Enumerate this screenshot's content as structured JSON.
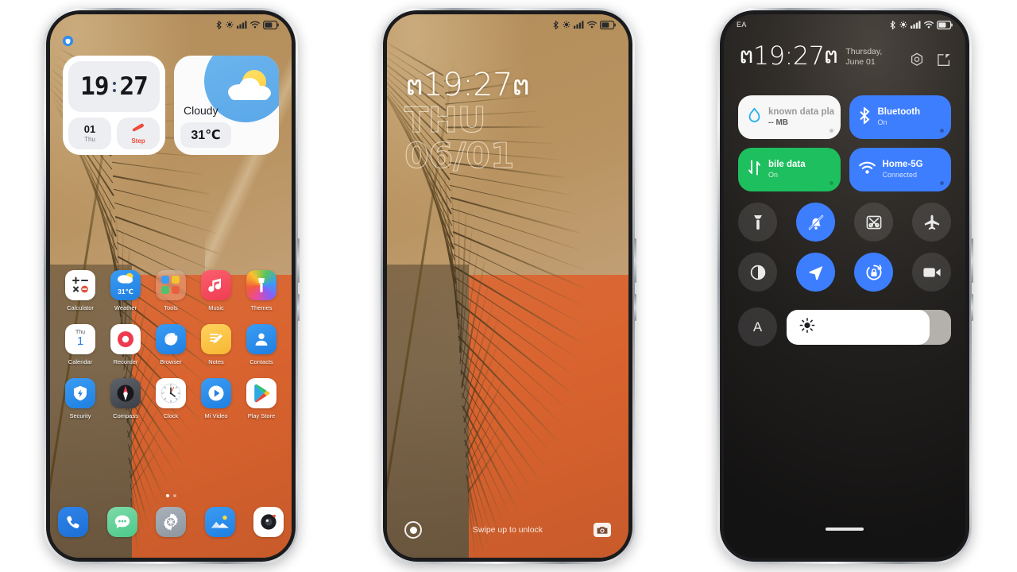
{
  "phone1": {
    "name": "home-screen",
    "status": {
      "carrier": "",
      "icons": [
        "bluetooth-icon",
        "nfc-icon",
        "signal-icon",
        "wifi-icon",
        "battery-icon"
      ]
    },
    "notification_badge": "security-shield-icon",
    "clock_widget": {
      "hours": "19",
      "minutes": "27",
      "day_number": "01",
      "day_name": "Thu",
      "step_label": "Step"
    },
    "weather_widget": {
      "condition": "Cloudy",
      "temperature": "31℃"
    },
    "apps_row1": [
      {
        "label": "Calculator",
        "icon": "calculator-icon"
      },
      {
        "label": "Weather",
        "icon": "weather-icon",
        "badge": "31℃"
      },
      {
        "label": "Tools",
        "icon": "tools-folder-icon"
      },
      {
        "label": "Music",
        "icon": "music-icon"
      },
      {
        "label": "Themes",
        "icon": "themes-icon"
      }
    ],
    "apps_row2": [
      {
        "label": "Calendar",
        "icon": "calendar-icon",
        "day_name": "Thu",
        "day_number": "1"
      },
      {
        "label": "Recorder",
        "icon": "recorder-icon"
      },
      {
        "label": "Browser",
        "icon": "browser-icon"
      },
      {
        "label": "Notes",
        "icon": "notes-icon"
      },
      {
        "label": "Contacts",
        "icon": "contacts-icon"
      }
    ],
    "apps_row3": [
      {
        "label": "Security",
        "icon": "security-icon"
      },
      {
        "label": "Compass",
        "icon": "compass-icon"
      },
      {
        "label": "Clock",
        "icon": "clock-icon"
      },
      {
        "label": "Mi Video",
        "icon": "mi-video-icon"
      },
      {
        "label": "Play Store",
        "icon": "play-store-icon"
      }
    ],
    "dock": [
      {
        "label": "Phone",
        "icon": "phone-icon"
      },
      {
        "label": "Messages",
        "icon": "messages-icon"
      },
      {
        "label": "Settings",
        "icon": "settings-gear-icon"
      },
      {
        "label": "Gallery",
        "icon": "gallery-icon"
      },
      {
        "label": "Camera",
        "icon": "camera-icon"
      }
    ],
    "page_indicator": {
      "pages": 2,
      "active": 1
    }
  },
  "phone2": {
    "name": "lock-screen",
    "status": {
      "icons": [
        "bluetooth-icon",
        "nfc-icon",
        "signal-icon",
        "wifi-icon",
        "battery-icon"
      ]
    },
    "clock": {
      "glyph_left": "ຕ",
      "time": "19:27",
      "glyph_right": "ຕ"
    },
    "date_line1": "THU",
    "date_line2": "06/01",
    "unlock_hint": "Swipe up to unlock",
    "left_shortcut": "fingerprint-icon",
    "right_shortcut": "camera-icon"
  },
  "phone3": {
    "name": "control-center",
    "status": {
      "carrier": "EA",
      "icons": [
        "bluetooth-icon",
        "nfc-icon",
        "signal-icon",
        "wifi-icon",
        "battery-icon"
      ]
    },
    "clock": {
      "glyph_left": "ຕ",
      "time": "19:27",
      "glyph_right": "ຕ"
    },
    "date_line1": "Thursday,",
    "date_line2": "June 01",
    "header_actions": [
      {
        "icon": "settings-hex-icon"
      },
      {
        "icon": "edit-icon"
      }
    ],
    "tiles": [
      {
        "title": "known data pla",
        "subtitle": "-- MB",
        "icon": "data-drop-icon",
        "state": "off"
      },
      {
        "title": "Bluetooth",
        "subtitle": "On",
        "icon": "bluetooth-icon",
        "state": "on"
      },
      {
        "title": "bile data",
        "subtitle": "On",
        "icon": "mobile-data-icon",
        "state": "on"
      },
      {
        "title": "Home-5G",
        "subtitle": "Connected",
        "icon": "wifi-icon",
        "state": "on"
      }
    ],
    "toggles_row1": [
      {
        "icon": "flashlight-icon",
        "state": "off"
      },
      {
        "icon": "silent-bell-icon",
        "state": "on"
      },
      {
        "icon": "screenshot-icon",
        "state": "off"
      },
      {
        "icon": "airplane-icon",
        "state": "off"
      }
    ],
    "toggles_row2": [
      {
        "icon": "dark-mode-icon",
        "state": "off"
      },
      {
        "icon": "location-icon",
        "state": "on"
      },
      {
        "icon": "rotation-lock-icon",
        "state": "on"
      },
      {
        "icon": "screen-recorder-icon",
        "state": "off"
      }
    ],
    "brightness": {
      "auto_label": "A",
      "value_percent": 87,
      "icon": "brightness-sun-icon"
    }
  },
  "colors": {
    "accent_blue": "#3d7eff",
    "accent_green": "#1dbf5e",
    "wall_tan": "#b8925f",
    "wall_orange": "#d9632f"
  }
}
